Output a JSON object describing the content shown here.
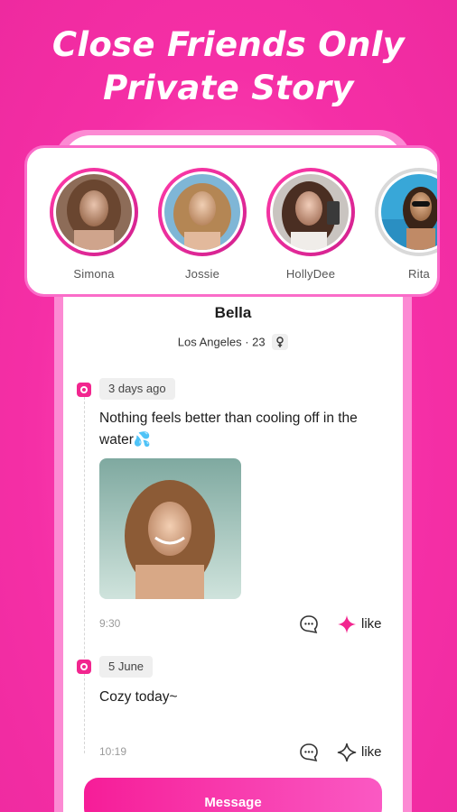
{
  "headline": {
    "line1": "Close Friends Only",
    "line2": "Private Story"
  },
  "stories": [
    {
      "name": "Simona",
      "ring": "pink"
    },
    {
      "name": "Jossie",
      "ring": "pink"
    },
    {
      "name": "HollyDee",
      "ring": "pink"
    },
    {
      "name": "Rita",
      "ring": "grey"
    }
  ],
  "profile": {
    "name": "Bella",
    "meta": "Los Angeles · 23",
    "gender_icon": "female-icon"
  },
  "posts": [
    {
      "date": "3 days ago",
      "text": "Nothing feels better than cooling off in the water💦",
      "has_image": true,
      "time": "9:30",
      "like_label": "like",
      "liked": true
    },
    {
      "date": "5 June",
      "text": "Cozy today~",
      "has_image": false,
      "time": "10:19",
      "like_label": "like",
      "liked": false
    }
  ],
  "message_button": {
    "label": "Message"
  },
  "colors": {
    "brand": "#f52fa6",
    "accent": "#f2268f",
    "frame": "#fc8ad3"
  }
}
